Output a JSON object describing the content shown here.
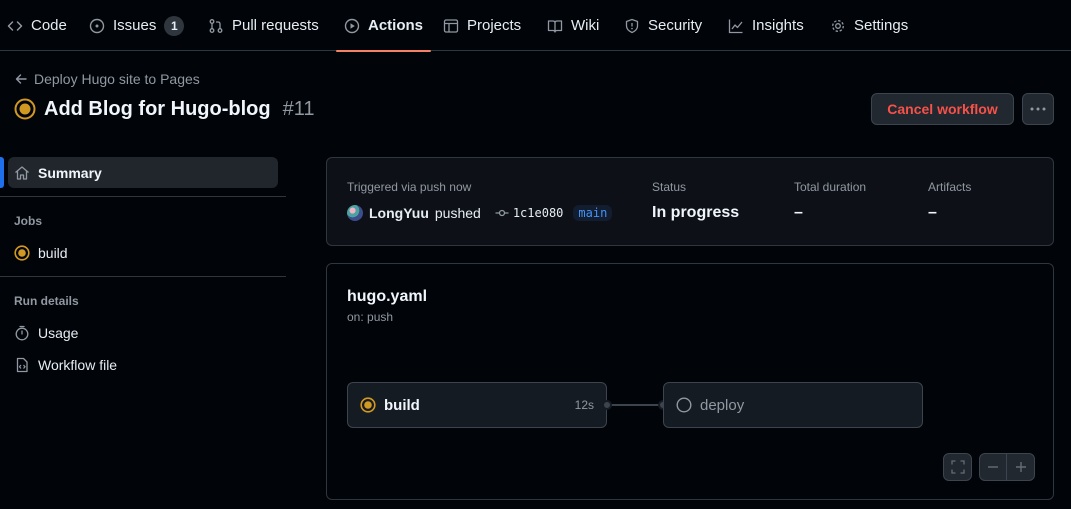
{
  "nav": {
    "items": [
      {
        "label": "Code",
        "icon": "code-icon"
      },
      {
        "label": "Issues",
        "icon": "issue-opened-icon",
        "count": "1"
      },
      {
        "label": "Pull requests",
        "icon": "git-pull-request-icon"
      },
      {
        "label": "Actions",
        "icon": "play-icon",
        "active": true
      },
      {
        "label": "Projects",
        "icon": "table-icon"
      },
      {
        "label": "Wiki",
        "icon": "book-icon"
      },
      {
        "label": "Security",
        "icon": "shield-icon"
      },
      {
        "label": "Insights",
        "icon": "graph-icon"
      },
      {
        "label": "Settings",
        "icon": "gear-icon"
      }
    ],
    "accent": "#f78166"
  },
  "header": {
    "back_label": "Deploy Hugo site to Pages",
    "title": "Add Blog for Hugo-blog",
    "run_number": "#11",
    "cancel_label": "Cancel workflow",
    "status_color": "#d29922"
  },
  "sidebar": {
    "summary_label": "Summary",
    "jobs_heading": "Jobs",
    "job_label": "build",
    "run_details_heading": "Run details",
    "usage_label": "Usage",
    "workflow_file_label": "Workflow file"
  },
  "summary": {
    "trigger_label": "Triggered via push now",
    "actor": "LongYuu",
    "action": "pushed",
    "commit": "1c1e080",
    "branch": "main",
    "status_label": "Status",
    "status_value": "In progress",
    "duration_label": "Total duration",
    "duration_value": "–",
    "artifacts_label": "Artifacts",
    "artifacts_value": "–"
  },
  "graph": {
    "workflow_name": "hugo.yaml",
    "trigger": "on: push",
    "jobs": [
      {
        "name": "build",
        "time": "12s",
        "status": "in_progress"
      },
      {
        "name": "deploy",
        "status": "pending"
      }
    ]
  }
}
